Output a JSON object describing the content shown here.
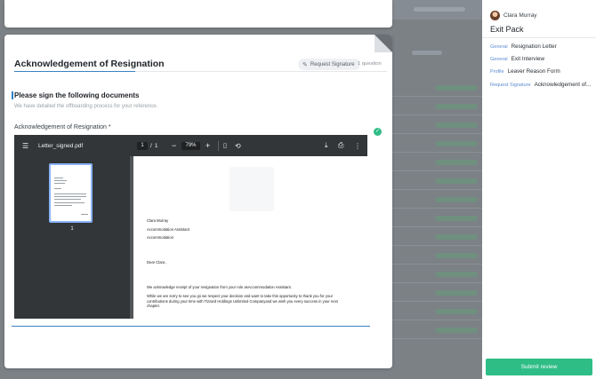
{
  "card": {
    "title": "Acknowledgement of Resignation",
    "badge_label": "Request Signature",
    "question_count": "1 question",
    "section_title": "Please sign the following documents",
    "section_subtitle": "We have detailed the offboarding process for your reference.",
    "field_label": "Acknowledgement of Resignation *"
  },
  "pdf": {
    "file_name": "Letter_signed.pdf",
    "current_page": "1",
    "page_separator": "/",
    "total_pages": "1",
    "zoom": "79%",
    "thumbnail_number": "1",
    "letter_lines": [
      "Clara Murray",
      "Accommodation Assistant",
      "Accommodation",
      "Dear Clara ,",
      "We acknowledge receipt of your resignation from your role asAccommodation Assistant.",
      "While we are sorry to see you go we respect your decision and want to take this opportunity to thank you for your contributions during your time with Tizzard Holdings Unlimited Companyand we wish you every success in your next chapter."
    ]
  },
  "panel": {
    "user_name": "Clara Murray",
    "title": "Exit Pack",
    "items": [
      {
        "category": "General",
        "name": "Resignation Letter"
      },
      {
        "category": "General",
        "name": "Exit Interview"
      },
      {
        "category": "Profile",
        "name": "Leaver Reason Form"
      },
      {
        "category": "Request Signature",
        "name": "Acknowledgement of..."
      }
    ],
    "submit_label": "Submit review"
  },
  "colors": {
    "accent_blue": "#3b82c4",
    "success_green": "#2ebd85"
  }
}
